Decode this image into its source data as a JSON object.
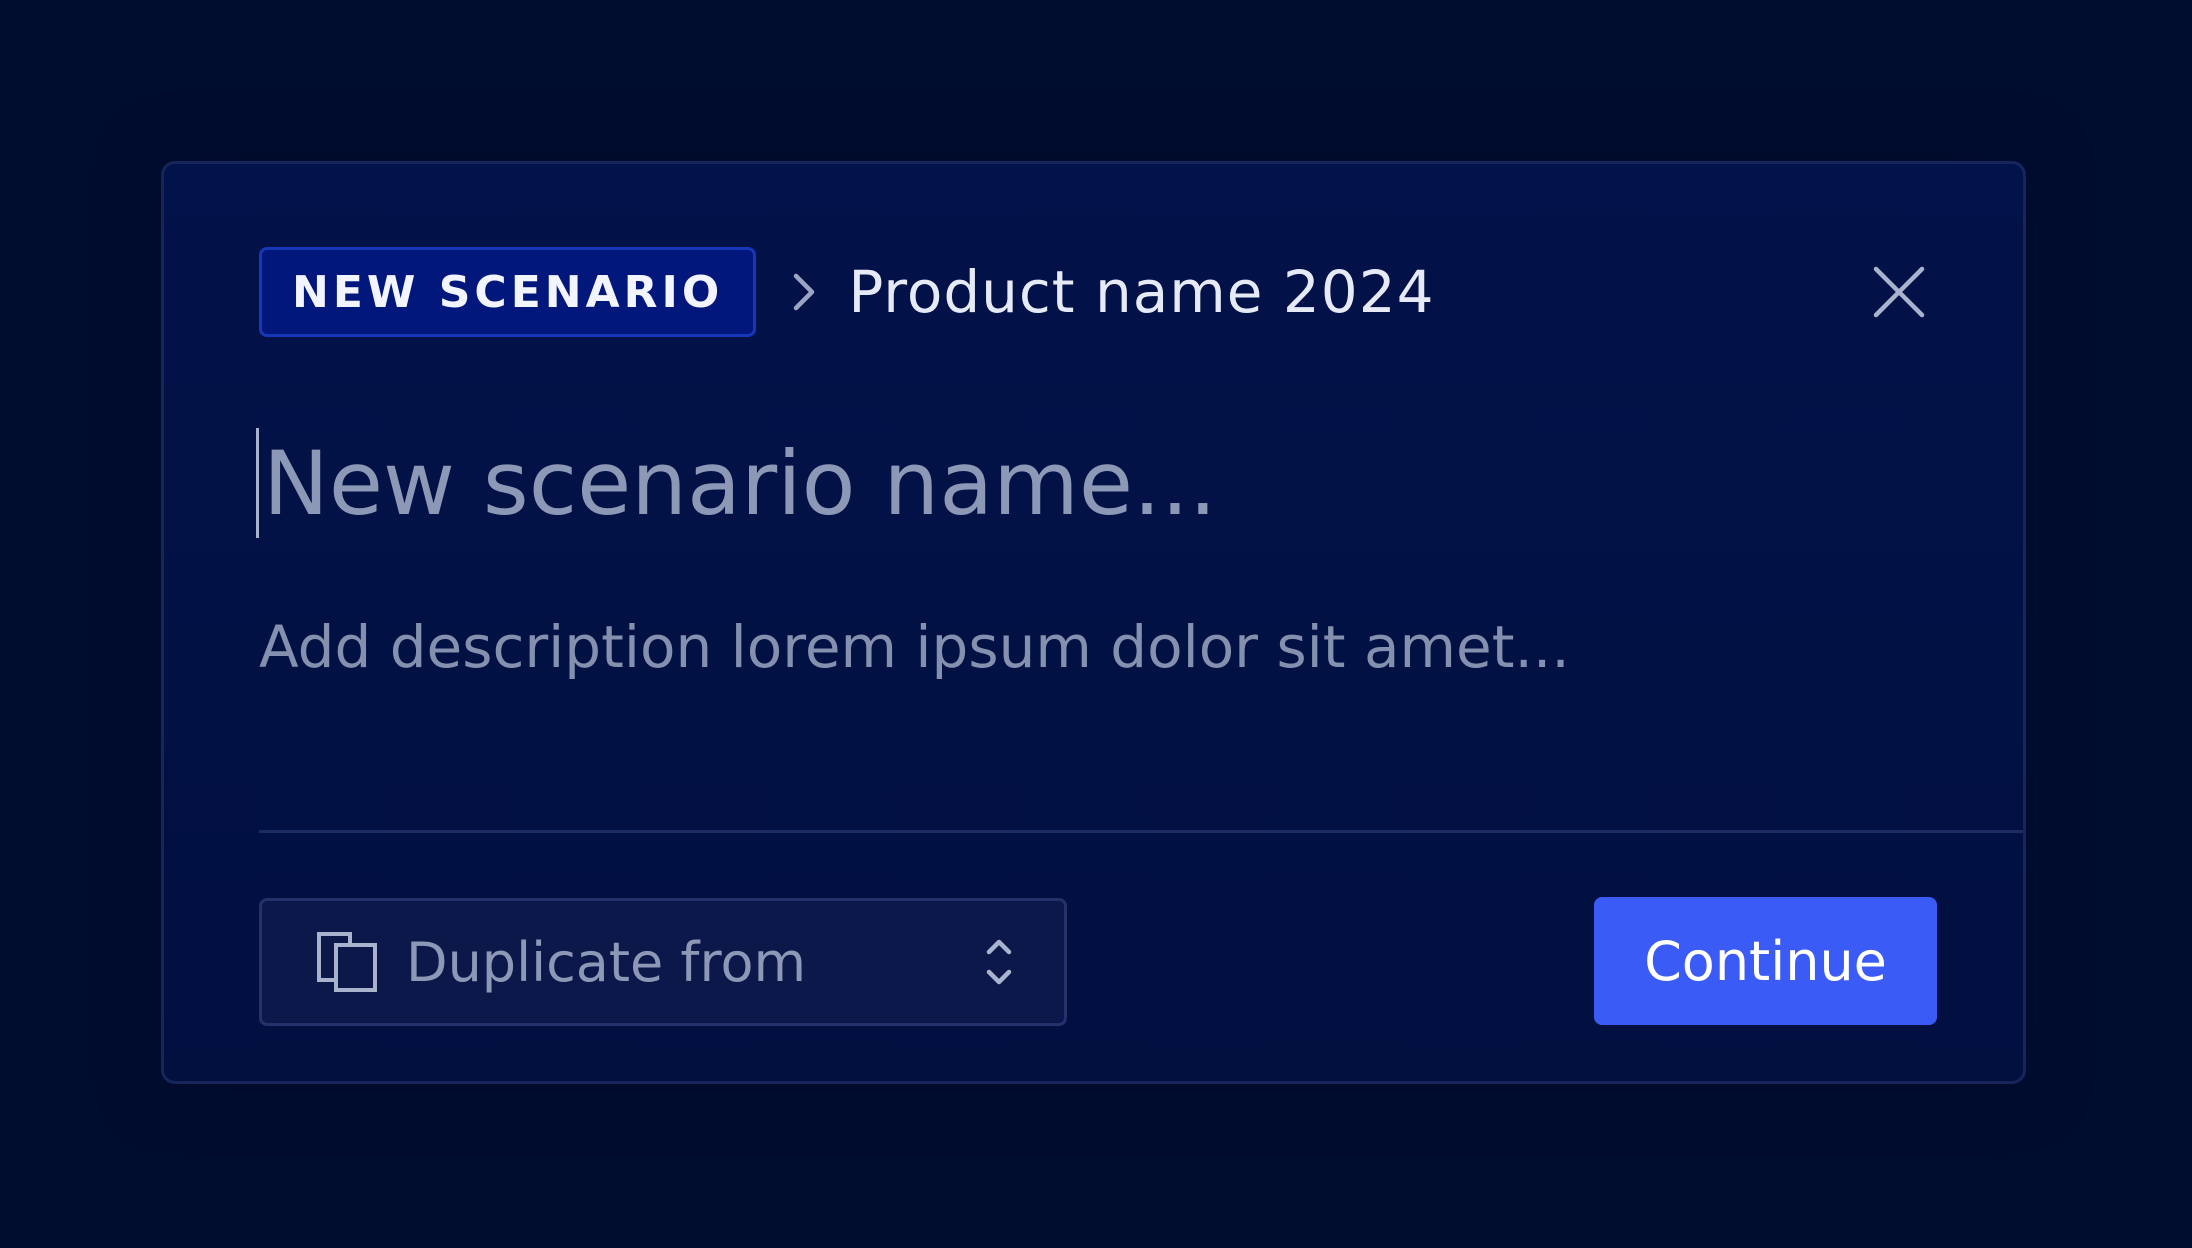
{
  "modal": {
    "badge_label": "NEW SCENARIO",
    "breadcrumb_title": "Product name 2024",
    "name_input": {
      "placeholder": "New scenario name...",
      "value": ""
    },
    "description_input": {
      "placeholder": "Add description lorem ipsum dolor sit amet...",
      "value": ""
    },
    "duplicate_select": {
      "label": "Duplicate from"
    },
    "continue_label": "Continue"
  },
  "icons": {
    "breadcrumb_separator": "chevron-right-icon",
    "close": "close-icon",
    "duplicate": "copy-icon",
    "select_arrows": "chevron-up-down-icon"
  },
  "colors": {
    "background": "#000d2f",
    "modal": "#02124a",
    "badge": "#02177b",
    "accent": "#3b5bf6"
  }
}
